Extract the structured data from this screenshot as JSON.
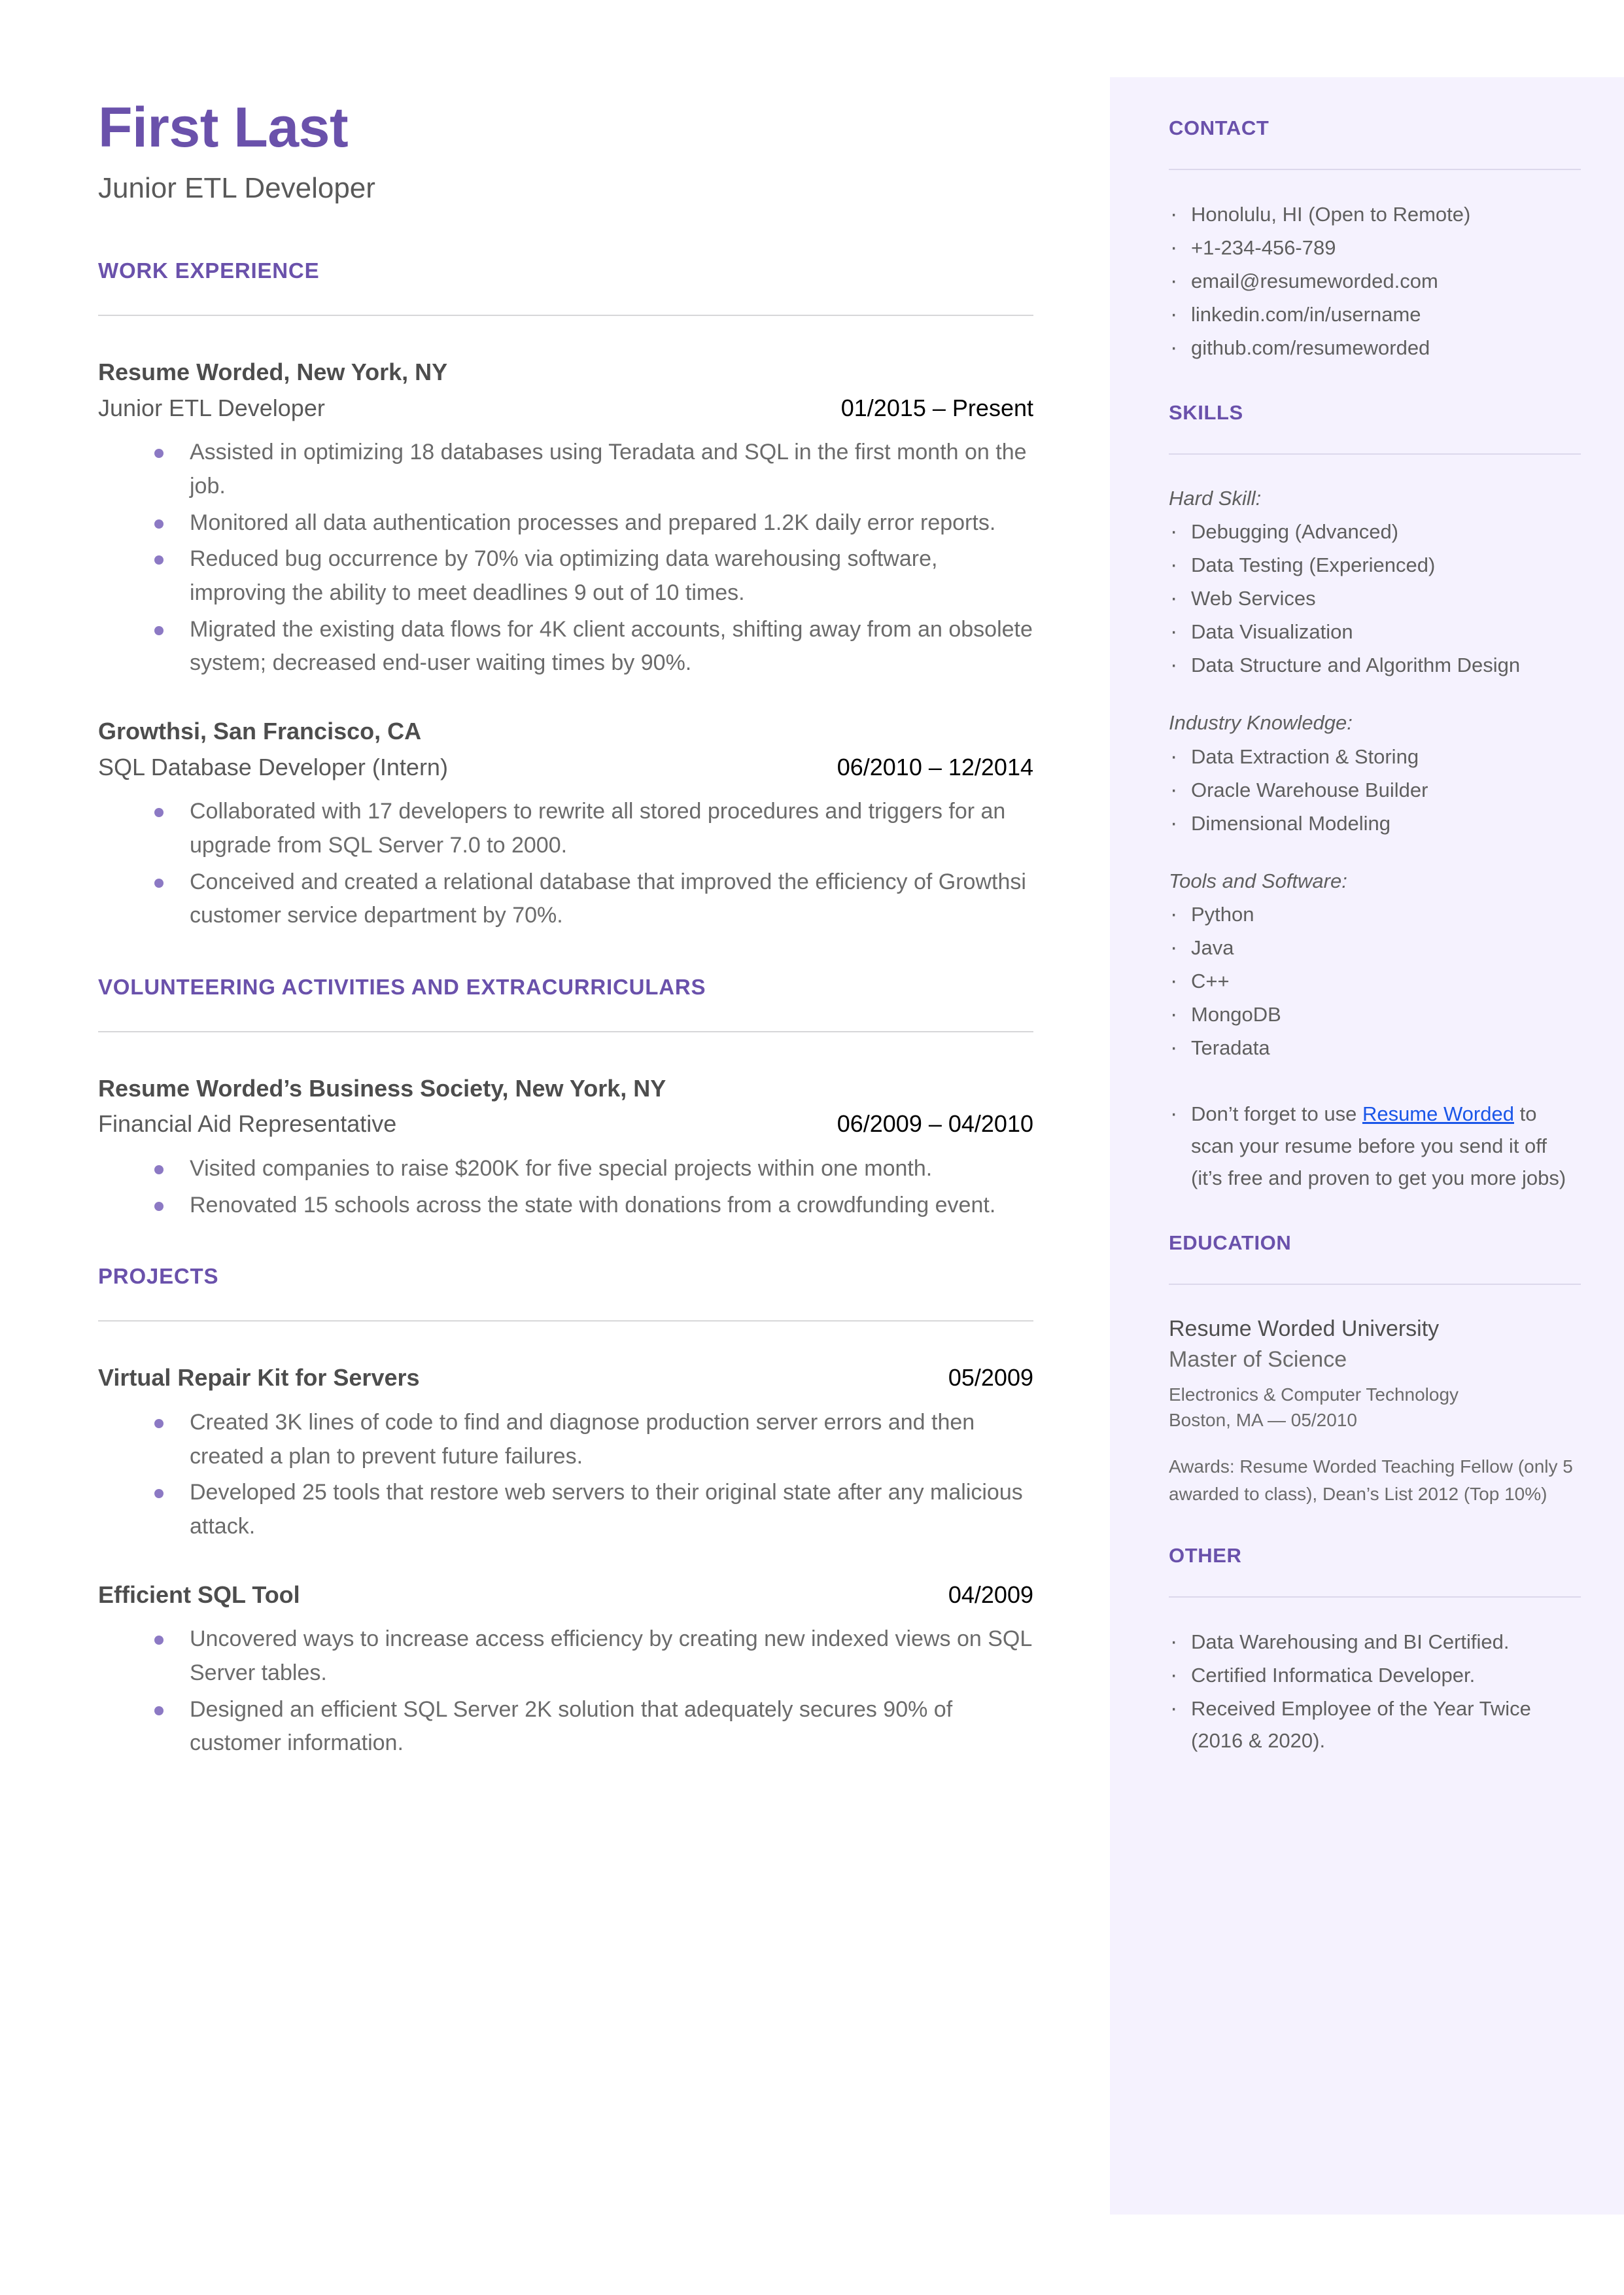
{
  "header": {
    "name": "First Last",
    "headline": "Junior ETL Developer"
  },
  "colors": {
    "accent_purple": "#6a51ab",
    "sidebar_bg": "#f5f2fe",
    "bullet_purple": "#8c79c4",
    "link_blue": "#1a56e8",
    "body_gray": "#6b6b6b",
    "divider_gray": "#d7d7d9"
  },
  "sections": {
    "work_experience": {
      "title": "WORK EXPERIENCE",
      "entries": [
        {
          "org": "Resume Worded, New York, NY",
          "role": "Junior ETL Developer",
          "date": "01/2015 – Present",
          "bullets": [
            "Assisted in optimizing 18 databases using Teradata and SQL in the first month on the job.",
            "Monitored all data authentication processes and prepared 1.2K daily error reports.",
            "Reduced bug occurrence by 70% via optimizing data warehousing software, improving the ability to meet deadlines 9 out of 10 times.",
            "Migrated the existing data flows for 4K client accounts, shifting away from an obsolete system; decreased end-user waiting times by 90%."
          ]
        },
        {
          "org": "Growthsi, San Francisco, CA",
          "role": "SQL Database Developer (Intern)",
          "date": "06/2010 – 12/2014",
          "bullets": [
            "Collaborated with 17 developers to rewrite all stored procedures and triggers for an upgrade from SQL Server 7.0 to 2000.",
            "Conceived and created a relational database that improved the efficiency of Growthsi customer service department by 70%."
          ]
        }
      ]
    },
    "volunteering": {
      "title": "VOLUNTEERING ACTIVITIES AND EXTRACURRICULARS",
      "entries": [
        {
          "org": "Resume Worded’s Business Society, New York, NY",
          "role": "Financial Aid Representative",
          "date": "06/2009 – 04/2010",
          "bullets": [
            "Visited companies to raise $200K for five special projects within one month.",
            "Renovated 15 schools across the state with donations from a crowdfunding event."
          ]
        }
      ]
    },
    "projects": {
      "title": "PROJECTS",
      "entries": [
        {
          "name": "Virtual Repair Kit for Servers",
          "date": "05/2009",
          "bullets": [
            "Created 3K lines of code to find and diagnose production server errors and then created a plan to prevent future failures.",
            "Developed 25 tools that restore web servers to their original state after any malicious attack."
          ]
        },
        {
          "name": "Efficient SQL Tool",
          "date": "04/2009",
          "bullets": [
            "Uncovered ways to increase access efficiency by creating new indexed views on SQL Server tables.",
            "Designed an efficient SQL Server 2K solution that adequately secures 90% of customer information."
          ]
        }
      ]
    }
  },
  "sidebar": {
    "contact": {
      "title": "CONTACT",
      "items": [
        "Honolulu, HI (Open to Remote)",
        "+1-234-456-789",
        "email@resumeworded.com",
        "linkedin.com/in/username",
        "github.com/resumeworded"
      ]
    },
    "skills": {
      "title": "SKILLS",
      "groups": [
        {
          "label": "Hard Skill:",
          "items": [
            "Debugging (Advanced)",
            "Data Testing (Experienced)",
            "Web Services",
            "Data Visualization",
            "Data Structure and Algorithm Design"
          ]
        },
        {
          "label": "Industry Knowledge:",
          "items": [
            "Data Extraction & Storing",
            "Oracle Warehouse Builder",
            "Dimensional Modeling"
          ]
        },
        {
          "label": "Tools and Software:",
          "items": [
            "Python",
            "Java",
            "C++",
            "MongoDB",
            "Teradata"
          ]
        }
      ],
      "note_prefix": "Don’t forget to use ",
      "note_link": "Resume Worded",
      "note_suffix": " to scan your resume before you send it off (it’s free and proven to get you more jobs)"
    },
    "education": {
      "title": "EDUCATION",
      "school": "Resume Worded University",
      "degree": "Master of Science",
      "field": "Electronics & Computer Technology",
      "location_date": "Boston, MA — 05/2010",
      "awards": "Awards: Resume Worded Teaching Fellow (only 5 awarded to class), Dean’s List 2012 (Top 10%)"
    },
    "other": {
      "title": "OTHER",
      "items": [
        "Data Warehousing and BI Certified.",
        "Certified Informatica Developer.",
        "Received Employee of the Year Twice (2016 & 2020)."
      ]
    }
  }
}
